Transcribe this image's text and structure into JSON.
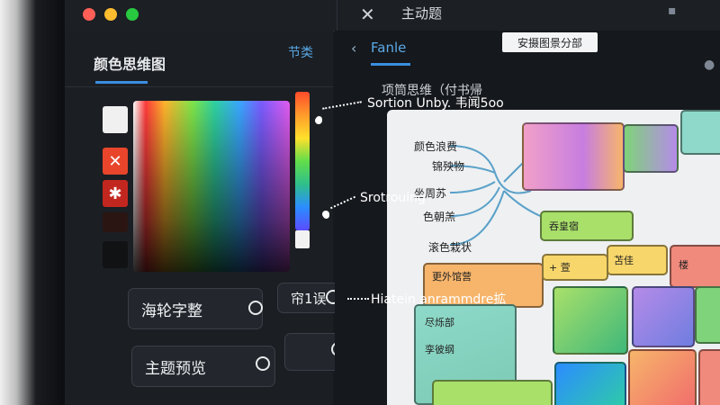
{
  "window": {
    "title": "主动题",
    "close_symbol": "✕",
    "traffic_lights": {
      "close": "#ff5f57",
      "minimize": "#febc2e",
      "zoom": "#28c840"
    }
  },
  "left_panel": {
    "title": "颜色思维图",
    "link": "节类",
    "swatches": [
      {
        "color": "#f0f0f0",
        "glyph": ""
      },
      {
        "color": "#e8452b",
        "glyph": "✕"
      },
      {
        "color": "#c2271f",
        "glyph": "✱"
      }
    ],
    "picker_accent": "#3b8ee0",
    "buttons": {
      "font_label": "海轮字整",
      "mode_label": "帘1误",
      "theme_preview_label": "主题预览"
    },
    "settings_symbol": "⚙"
  },
  "main": {
    "back_symbol": "‹",
    "tab_label": "Fanle",
    "title": "项筒思维（付书帰",
    "header_button": "安摄图景分部",
    "canvas": {
      "left_labels": [
        "颜色浪费",
        "锦殃物",
        "坐周苏",
        "色朝羔",
        "滚色栽状"
      ],
      "node_texts": [
        "吞皇宿",
        "尽烁部",
        "孪彼纲",
        "更外馆营",
        "苫佳",
        "楼"
      ],
      "plus_labels": [
        "+ 萱",
        "+"
      ],
      "node_colors": {
        "pink": "#f1a0c8",
        "green": "#a9e06a",
        "orange": "#f7b56b",
        "teal": "#8ed9c9",
        "purple": "#b58be8",
        "red": "#f08a7c"
      }
    }
  },
  "callouts": [
    "Sortion  Unby. 韦闻5oo",
    "Srotrouing",
    "Hiatein anrammdre拡"
  ]
}
